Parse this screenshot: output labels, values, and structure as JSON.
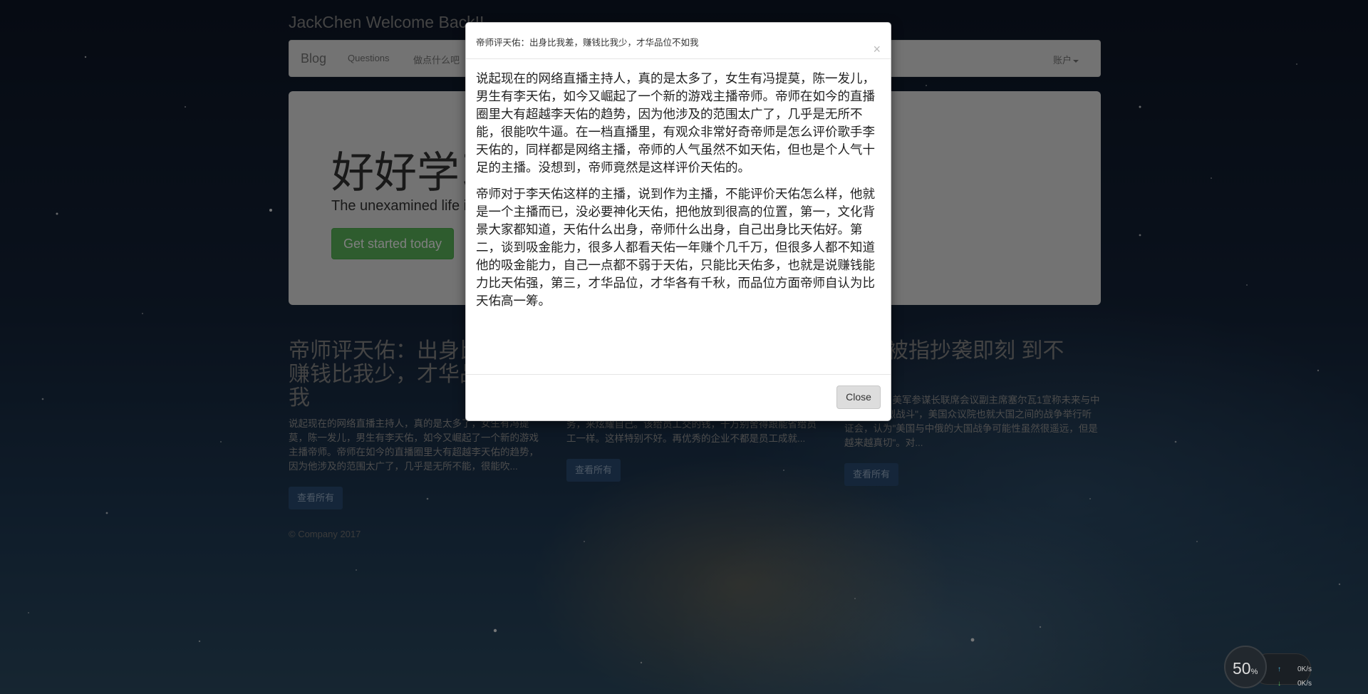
{
  "page": {
    "brand": "JackChen Welcome Back!!",
    "nav": {
      "brand": "Blog",
      "links": [
        "Questions",
        "做点什么吧"
      ],
      "account": "账户"
    },
    "jumbotron": {
      "title": "好好学习",
      "lead": "The unexamined life is not worth living",
      "button": "Get started today"
    },
    "columns": [
      {
        "title": "帝师评天佑：出身比我差，赚钱比我少，才华品位不如我",
        "excerpt": "说起现在的网络直播主持人，真的是太多了，女生有冯提莫，陈一发儿，男生有李天佑，如今又崛起了一个新的游戏主播帝师。帝师在如今的直播圈里大有超越李天佑的趋势，因为他涉及的范围太广了，几乎是无所不能，很能吹...",
        "button": "查看所有"
      },
      {
        "title": "",
        "excerpt": "务，来炫耀自己。该给员工交的钱，千万别舍得跟能省给员工一样。这样特别不好。再优秀的企业不都是员工成就...",
        "button": "查看所有"
      },
      {
        "title": "立知被指抄袭即刻 到不冤？",
        "excerpt": "综合报道】美军参谋长联席会议副主席塞尔瓦1宣称未来与中俄\"面临激烈战斗\"，美国众议院也就大国之间的战争举行听证会，认为\"美国与中俄的大国战争可能性虽然很遥远，但是越来越真切\"。对...",
        "button": "查看所有"
      }
    ],
    "footer": "© Company 2017"
  },
  "modal": {
    "title": "帝师评天佑：出身比我差，赚钱比我少，才华品位不如我",
    "close_x": "×",
    "paragraphs": [
      "说起现在的网络直播主持人，真的是太多了，女生有冯提莫，陈一发儿，男生有李天佑，如今又崛起了一个新的游戏主播帝师。帝师在如今的直播圈里大有超越李天佑的趋势，因为他涉及的范围太广了，几乎是无所不能，很能吹牛逼。在一档直播里，有观众非常好奇帝师是怎么评价歌手李天佑的，同样都是网络主播，帝师的人气虽然不如天佑，但也是个人气十足的主播。没想到，帝师竟然是这样评价天佑的。",
      "帝师对于李天佑这样的主播，说到作为主播，不能评价天佑怎么样，他就是一个主播而已，没必要神化天佑，把他放到很高的位置，第一，文化背景大家都知道，天佑什么出身，帝师什么出身，自己出身比天佑好。第二，谈到吸金能力，很多人都看天佑一年赚个几千万，但很多人都不知道他的吸金能力，自己一点都不弱于天佑，只能比天佑多，也就是说赚钱能力比天佑强，第三，才华品位，才华各有千秋，而品位方面帝师自认为比天佑高一筹。"
    ],
    "close_button": "Close"
  },
  "net_widget": {
    "percent": "50",
    "percent_unit": "%",
    "up": "0K/s",
    "down": "0K/s"
  }
}
